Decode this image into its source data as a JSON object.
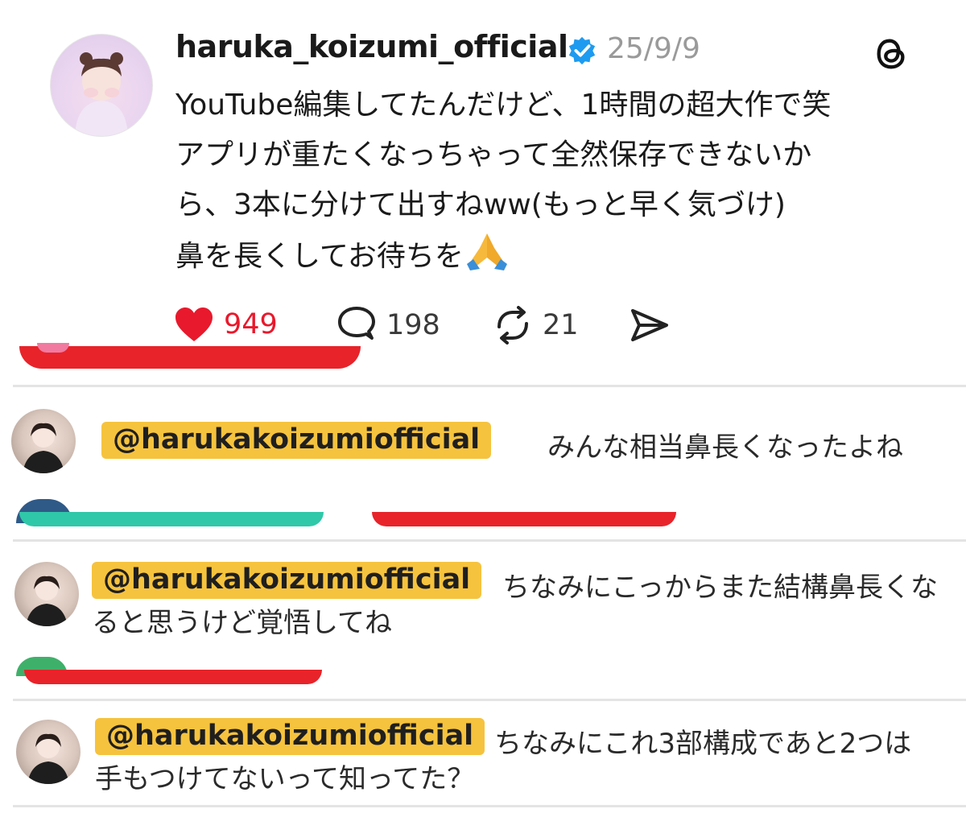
{
  "post": {
    "username": "haruka_koizumi_official",
    "date": "25/9/9",
    "lines": [
      "YouTube編集してたんだけど、1時間の超大作で笑",
      "アプリが重たくなっちゃって全然保存できないか",
      "ら、3本に分けて出すねww(もっと早く気づけ)",
      "鼻を長くしてお待ちを"
    ],
    "icons": {
      "verified": "verified-badge-icon",
      "app": "threads-logo-icon",
      "emoji": "folded-hands-icon"
    }
  },
  "actions": {
    "likes": "949",
    "replies": "198",
    "reposts": "21",
    "like_color": "#e8192c"
  },
  "comments": [
    {
      "mention": "@harukakoizumiofficial",
      "text_line1": "みんな相当鼻長くなったよね",
      "text_line2": ""
    },
    {
      "mention": "@harukakoizumiofficial",
      "text_line1": "ちなみにこっからまた結構鼻長くな",
      "text_line2": "ると思うけど覚悟してね"
    },
    {
      "mention": "@harukakoizumiofficial",
      "text_line1": "ちなみにこれ3部構成であと2つは",
      "text_line2": "手もつけてないって知ってた？"
    }
  ],
  "colors": {
    "highlight": "#f6c33e",
    "strip_red": "#e8232a",
    "strip_teal": "#2fc8a8"
  }
}
